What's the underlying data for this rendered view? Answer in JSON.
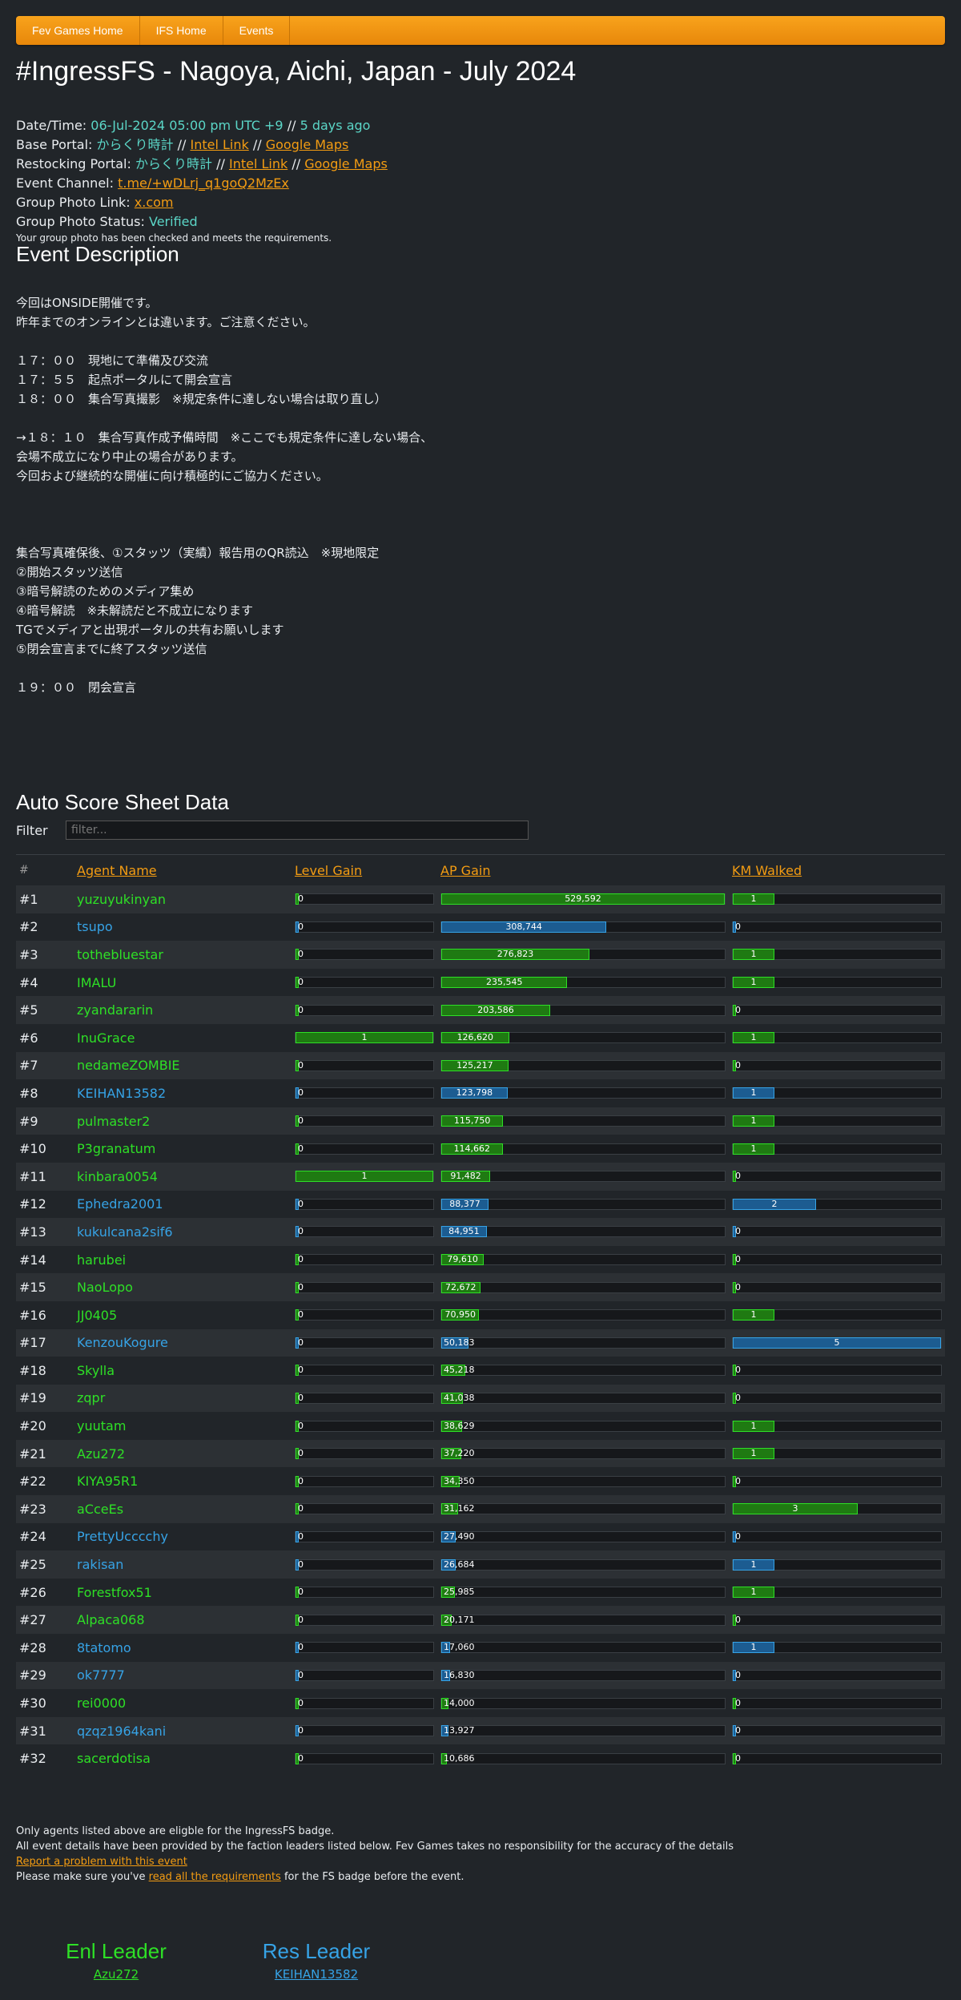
{
  "nav": {
    "items": [
      "Fev Games Home",
      "IFS Home",
      "Events"
    ]
  },
  "title": "#IngressFS - Nagoya, Aichi, Japan - July 2024",
  "info": {
    "datetime_label": "Date/Time:",
    "datetime_value": "06-Jul-2024 05:00 pm UTC +9",
    "datetime_sep": "//",
    "datetime_ago": "5 days ago",
    "base_label": "Base Portal:",
    "base_name": "からくり時計",
    "restock_label": "Restocking Portal:",
    "restock_name": "からくり時計",
    "intel_link": "Intel Link",
    "maps_link": "Google Maps",
    "sep": "//",
    "channel_label": "Event Channel:",
    "channel_link": "t.me/+wDLrj_q1goQ2MzEx",
    "photo_label": "Group Photo Link:",
    "photo_link": "x.com",
    "status_label": "Group Photo Status:",
    "status_value": "Verified",
    "status_note": "Your group photo has been checked and meets the requirements."
  },
  "description": {
    "title": "Event Description",
    "text": "今回はONSIDE開催です。\n昨年までのオンラインとは違います。ご注意ください。\n\n１７：００　現地にて準備及び交流\n１７：５５　起点ポータルにて開会宣言\n１８：００　集合写真撮影　※規定条件に達しない場合は取り直し）\n\n→１８：１０　集合写真作成予備時間　※ここでも規定条件に達しない場合、\n会場不成立になり中止の場合があります。\n今回および継続的な開催に向け積極的にご協力ください。\n\n\n\n集合写真確保後、①スタッツ（実績）報告用のQR読込　※現地限定\n②開始スタッツ送信\n③暗号解読のためのメディア集め\n④暗号解読　※未解読だと不成立になります\nTGでメディアと出現ポータルの共有お願いします\n⑤閉会宣言までに終了スタッツ送信\n\n１９：００　閉会宣言"
  },
  "scores": {
    "title": "Auto Score Sheet Data",
    "filter_label": "Filter",
    "filter_placeholder": "filter...",
    "headers": {
      "num": "#",
      "agent": "Agent Name",
      "level": "Level Gain",
      "ap": "AP Gain",
      "km": "KM Walked"
    },
    "max": {
      "level": 1,
      "ap": 529592,
      "km": 5
    },
    "rows": [
      {
        "rank": "#1",
        "agent": "yuzuyukinyan",
        "faction": "enl",
        "level": 0,
        "ap": 529592,
        "ap_label": "529,592",
        "km": 1
      },
      {
        "rank": "#2",
        "agent": "tsupo",
        "faction": "res",
        "level": 0,
        "ap": 308744,
        "ap_label": "308,744",
        "km": 0
      },
      {
        "rank": "#3",
        "agent": "tothebluestar",
        "faction": "enl",
        "level": 0,
        "ap": 276823,
        "ap_label": "276,823",
        "km": 1
      },
      {
        "rank": "#4",
        "agent": "IMALU",
        "faction": "enl",
        "level": 0,
        "ap": 235545,
        "ap_label": "235,545",
        "km": 1
      },
      {
        "rank": "#5",
        "agent": "zyandararin",
        "faction": "enl",
        "level": 0,
        "ap": 203586,
        "ap_label": "203,586",
        "km": 0
      },
      {
        "rank": "#6",
        "agent": "InuGrace",
        "faction": "enl",
        "level": 1,
        "ap": 126620,
        "ap_label": "126,620",
        "km": 1
      },
      {
        "rank": "#7",
        "agent": "nedameZOMBIE",
        "faction": "enl",
        "level": 0,
        "ap": 125217,
        "ap_label": "125,217",
        "km": 0
      },
      {
        "rank": "#8",
        "agent": "KEIHAN13582",
        "faction": "res",
        "level": 0,
        "ap": 123798,
        "ap_label": "123,798",
        "km": 1
      },
      {
        "rank": "#9",
        "agent": "pulmaster2",
        "faction": "enl",
        "level": 0,
        "ap": 115750,
        "ap_label": "115,750",
        "km": 1
      },
      {
        "rank": "#10",
        "agent": "P3granatum",
        "faction": "enl",
        "level": 0,
        "ap": 114662,
        "ap_label": "114,662",
        "km": 1
      },
      {
        "rank": "#11",
        "agent": "kinbara0054",
        "faction": "enl",
        "level": 1,
        "ap": 91482,
        "ap_label": "91,482",
        "km": 0
      },
      {
        "rank": "#12",
        "agent": "Ephedra2001",
        "faction": "res",
        "level": 0,
        "ap": 88377,
        "ap_label": "88,377",
        "km": 2
      },
      {
        "rank": "#13",
        "agent": "kukulcana2sif6",
        "faction": "res",
        "level": 0,
        "ap": 84951,
        "ap_label": "84,951",
        "km": 0
      },
      {
        "rank": "#14",
        "agent": "harubei",
        "faction": "enl",
        "level": 0,
        "ap": 79610,
        "ap_label": "79,610",
        "km": 0
      },
      {
        "rank": "#15",
        "agent": "NaoLopo",
        "faction": "enl",
        "level": 0,
        "ap": 72672,
        "ap_label": "72,672",
        "km": 0
      },
      {
        "rank": "#16",
        "agent": "JJ0405",
        "faction": "enl",
        "level": 0,
        "ap": 70950,
        "ap_label": "70,950",
        "km": 1
      },
      {
        "rank": "#17",
        "agent": "KenzouKogure",
        "faction": "res",
        "level": 0,
        "ap": 50183,
        "ap_label": "50,183",
        "km": 5
      },
      {
        "rank": "#18",
        "agent": "Skylla",
        "faction": "enl",
        "level": 0,
        "ap": 45218,
        "ap_label": "45,218",
        "km": 0
      },
      {
        "rank": "#19",
        "agent": "zqpr",
        "faction": "enl",
        "level": 0,
        "ap": 41038,
        "ap_label": "41,038",
        "km": 0
      },
      {
        "rank": "#20",
        "agent": "yuutam",
        "faction": "enl",
        "level": 0,
        "ap": 38629,
        "ap_label": "38,629",
        "km": 1
      },
      {
        "rank": "#21",
        "agent": "Azu272",
        "faction": "enl",
        "level": 0,
        "ap": 37220,
        "ap_label": "37,220",
        "km": 1
      },
      {
        "rank": "#22",
        "agent": "KIYA95R1",
        "faction": "enl",
        "level": 0,
        "ap": 34350,
        "ap_label": "34,350",
        "km": 0
      },
      {
        "rank": "#23",
        "agent": "aCceEs",
        "faction": "enl",
        "level": 0,
        "ap": 31162,
        "ap_label": "31,162",
        "km": 3
      },
      {
        "rank": "#24",
        "agent": "PrettyUcccchy",
        "faction": "res",
        "level": 0,
        "ap": 27490,
        "ap_label": "27,490",
        "km": 0
      },
      {
        "rank": "#25",
        "agent": "rakisan",
        "faction": "res",
        "level": 0,
        "ap": 26684,
        "ap_label": "26,684",
        "km": 1
      },
      {
        "rank": "#26",
        "agent": "Forestfox51",
        "faction": "enl",
        "level": 0,
        "ap": 25985,
        "ap_label": "25,985",
        "km": 1
      },
      {
        "rank": "#27",
        "agent": "Alpaca068",
        "faction": "enl",
        "level": 0,
        "ap": 20171,
        "ap_label": "20,171",
        "km": 0
      },
      {
        "rank": "#28",
        "agent": "8tatomo",
        "faction": "res",
        "level": 0,
        "ap": 17060,
        "ap_label": "17,060",
        "km": 1
      },
      {
        "rank": "#29",
        "agent": "ok7777",
        "faction": "res",
        "level": 0,
        "ap": 16830,
        "ap_label": "16,830",
        "km": 0
      },
      {
        "rank": "#30",
        "agent": "rei0000",
        "faction": "enl",
        "level": 0,
        "ap": 14000,
        "ap_label": "14,000",
        "km": 0
      },
      {
        "rank": "#31",
        "agent": "qzqz1964kani",
        "faction": "res",
        "level": 0,
        "ap": 13927,
        "ap_label": "13,927",
        "km": 0
      },
      {
        "rank": "#32",
        "agent": "sacerdotisa",
        "faction": "enl",
        "level": 0,
        "ap": 10686,
        "ap_label": "10,686",
        "km": 0
      }
    ]
  },
  "footer": {
    "line1": "Only agents listed above are eligble for the IngressFS badge.",
    "line2": "All event details have been provided by the faction leaders listed below. Fev Games takes no responsibility for the accuracy of the details",
    "report_link": "Report a problem with this event",
    "line4_pre": "Please make sure you've ",
    "line4_link": "read all the requirements",
    "line4_post": " for the FS badge before the event."
  },
  "leaders": {
    "enl_role": "Enl Leader",
    "enl_name": "Azu272",
    "res_role": "Res Leader",
    "res_name": "KEIHAN13582"
  },
  "colors": {
    "enl": "#2ee026",
    "res": "#36a3e6",
    "accent": "#f39c12",
    "teal": "#5bd6c7",
    "background": "#212529"
  }
}
